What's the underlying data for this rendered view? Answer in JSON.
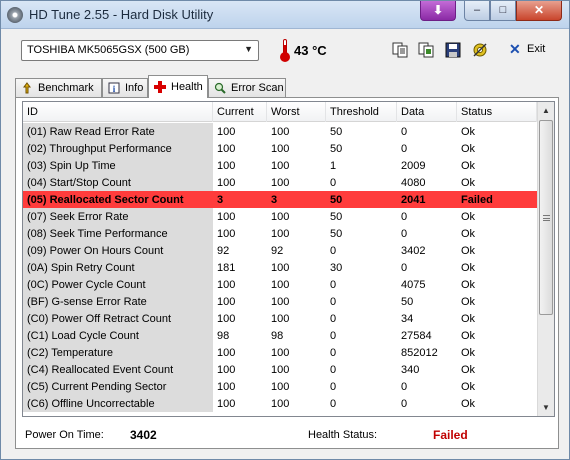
{
  "window": {
    "title": "HD Tune 2.55 - Hard Disk Utility",
    "download_glyph": "⬇",
    "minimize_glyph": "–",
    "maximize_glyph": "□",
    "close_glyph": "✕"
  },
  "toolbar": {
    "drive": "TOSHIBA MK5065GSX (500 GB)",
    "temperature": "43 °C",
    "exit_label": "Exit",
    "icons": [
      "copy-text-icon",
      "copy-screenshot-icon",
      "save-icon",
      "options-icon",
      "thermometer-icon",
      "exit-icon"
    ]
  },
  "tabs": [
    {
      "label": "Benchmark",
      "icon": "benchmark-icon",
      "active": false
    },
    {
      "label": "Info",
      "icon": "info-icon",
      "active": false
    },
    {
      "label": "Health",
      "icon": "health-cross-icon",
      "active": true
    },
    {
      "label": "Error Scan",
      "icon": "magnifier-icon",
      "active": false
    }
  ],
  "table": {
    "columns": [
      "ID",
      "Current",
      "Worst",
      "Threshold",
      "Data",
      "Status"
    ],
    "rows": [
      [
        "(01) Raw Read Error Rate",
        "100",
        "100",
        "50",
        "0",
        "Ok"
      ],
      [
        "(02) Throughput Performance",
        "100",
        "100",
        "50",
        "0",
        "Ok"
      ],
      [
        "(03) Spin Up Time",
        "100",
        "100",
        "1",
        "2009",
        "Ok"
      ],
      [
        "(04) Start/Stop Count",
        "100",
        "100",
        "0",
        "4080",
        "Ok"
      ],
      [
        "(05) Reallocated Sector Count",
        "3",
        "3",
        "50",
        "2041",
        "Failed"
      ],
      [
        "(07) Seek Error Rate",
        "100",
        "100",
        "50",
        "0",
        "Ok"
      ],
      [
        "(08) Seek Time Performance",
        "100",
        "100",
        "50",
        "0",
        "Ok"
      ],
      [
        "(09) Power On Hours Count",
        "92",
        "92",
        "0",
        "3402",
        "Ok"
      ],
      [
        "(0A) Spin Retry Count",
        "181",
        "100",
        "30",
        "0",
        "Ok"
      ],
      [
        "(0C) Power Cycle Count",
        "100",
        "100",
        "0",
        "4075",
        "Ok"
      ],
      [
        "(BF) G-sense Error Rate",
        "100",
        "100",
        "0",
        "50",
        "Ok"
      ],
      [
        "(C0) Power Off Retract Count",
        "100",
        "100",
        "0",
        "34",
        "Ok"
      ],
      [
        "(C1) Load Cycle Count",
        "98",
        "98",
        "0",
        "27584",
        "Ok"
      ],
      [
        "(C2) Temperature",
        "100",
        "100",
        "0",
        "852012",
        "Ok"
      ],
      [
        "(C4) Reallocated Event Count",
        "100",
        "100",
        "0",
        "340",
        "Ok"
      ],
      [
        "(C5) Current Pending Sector",
        "100",
        "100",
        "0",
        "0",
        "Ok"
      ],
      [
        "(C6) Offline Uncorrectable",
        "100",
        "100",
        "0",
        "0",
        "Ok"
      ]
    ],
    "failed_row_color": "#ff3c3c"
  },
  "footer": {
    "power_on_label": "Power On Time:",
    "power_on_value": "3402",
    "health_label": "Health Status:",
    "health_value": "Failed",
    "health_color": "#c00000"
  }
}
